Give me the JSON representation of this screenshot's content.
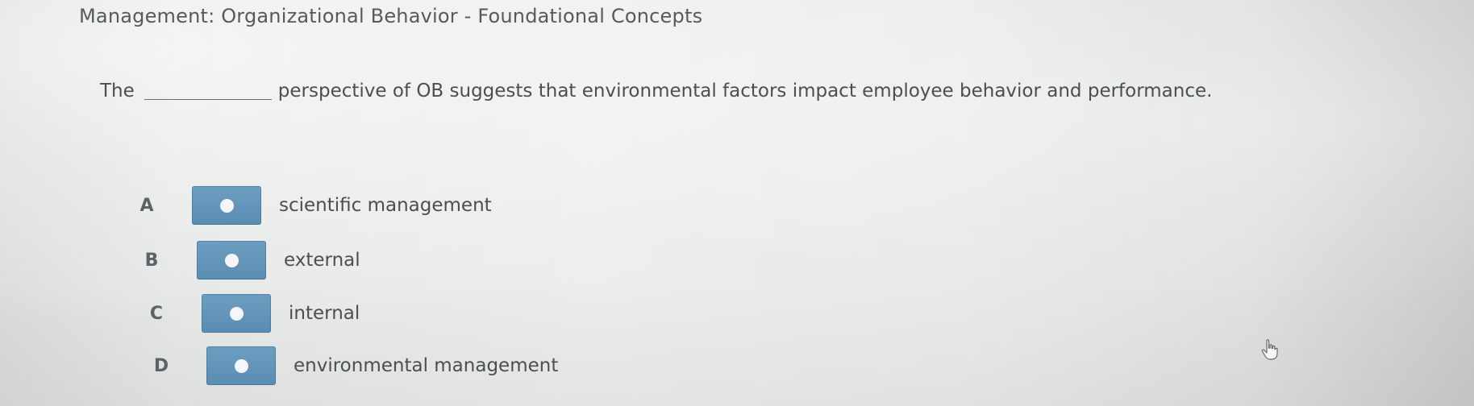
{
  "header": {
    "title": "Management: Organizational Behavior - Foundational Concepts"
  },
  "question": {
    "prefix": "The",
    "suffix": "perspective of OB suggests that environmental factors impact employee behavior and performance."
  },
  "options": [
    {
      "letter": "A",
      "label": "scientific management"
    },
    {
      "letter": "B",
      "label": "external"
    },
    {
      "letter": "C",
      "label": "internal"
    },
    {
      "letter": "D",
      "label": "environmental management"
    }
  ],
  "colors": {
    "radio_button": "#5f92b7",
    "radio_dot": "#f4f6f7",
    "text": "#4a4f52"
  },
  "icons": {
    "cursor": "hand-pointer-icon",
    "radio": "radio-dot-icon"
  }
}
